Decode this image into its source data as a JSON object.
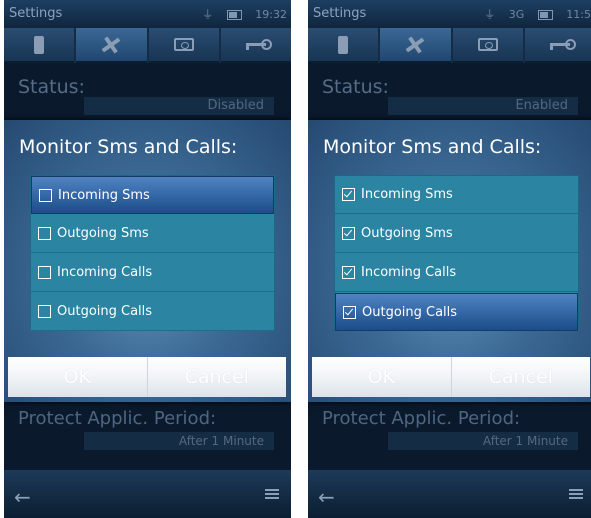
{
  "screens": [
    {
      "statusbar": {
        "title": "Settings",
        "signal": "⏚",
        "net": "",
        "clock": "19:32"
      },
      "status": {
        "label": "Status:",
        "value": "Disabled"
      },
      "dialog": {
        "title": "Monitor Sms and Calls:",
        "items": [
          {
            "label": "Incoming Sms",
            "checked": false,
            "highlighted": true
          },
          {
            "label": "Outgoing Sms",
            "checked": false,
            "highlighted": false
          },
          {
            "label": "Incoming Calls",
            "checked": false,
            "highlighted": false
          },
          {
            "label": "Outgoing Calls",
            "checked": false,
            "highlighted": false
          }
        ],
        "ok_label": "OK",
        "cancel_label": "Cancel"
      },
      "protect": {
        "label": "Protect Applic. Period:",
        "value": "After 1 Minute"
      }
    },
    {
      "statusbar": {
        "title": "Settings",
        "signal": "⏚",
        "net": "3G",
        "clock": "11:5"
      },
      "status": {
        "label": "Status:",
        "value": "Enabled"
      },
      "dialog": {
        "title": "Monitor Sms and Calls:",
        "items": [
          {
            "label": "Incoming Sms",
            "checked": true,
            "highlighted": false
          },
          {
            "label": "Outgoing Sms",
            "checked": true,
            "highlighted": false
          },
          {
            "label": "Incoming Calls",
            "checked": true,
            "highlighted": false
          },
          {
            "label": "Outgoing Calls",
            "checked": true,
            "highlighted": true
          }
        ],
        "ok_label": "OK",
        "cancel_label": "Cancel"
      },
      "protect": {
        "label": "Protect Applic. Period:",
        "value": "After 1 Minute"
      }
    }
  ],
  "icons": {
    "tabs": [
      "phone-icon",
      "tools-icon",
      "camera-icon",
      "key-icon"
    ],
    "back": "back-arrow-icon",
    "menu": "menu-icon",
    "battery": "battery-icon"
  },
  "colors": {
    "dialog_bg": "#3b6994",
    "list_bg": "#2a84a2",
    "highlight": "#1c4d8a",
    "button_bg": "#f1f4f7"
  }
}
